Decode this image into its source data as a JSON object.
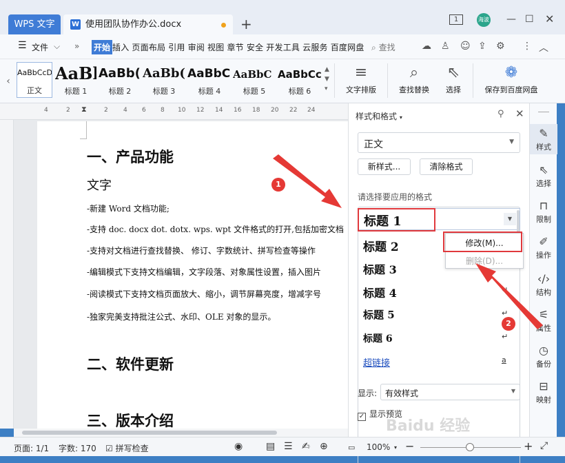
{
  "titlebar": {
    "app_tab": "WPS 文字",
    "doc_tab": "使用团队协作办公.docx",
    "new_tab": "+",
    "badge_count": "1",
    "avatar_text": "海波"
  },
  "menubar": {
    "file_label": "文件",
    "start_label": "开始",
    "items": "插入 页面布局 引用 审阅 视图 章节 安全 开发工具 云服务 百度网盘",
    "search_label": "查找"
  },
  "ribbon": {
    "styles": [
      {
        "preview": "AaBbCcDd",
        "label": "正文"
      },
      {
        "preview": "AaBl",
        "label": "标题 1"
      },
      {
        "preview": "AaBb(",
        "label": "标题 2"
      },
      {
        "preview": "AaBb(",
        "label": "标题 3"
      },
      {
        "preview": "AaBbC",
        "label": "标题 4"
      },
      {
        "preview": "AaBbC",
        "label": "标题 5"
      },
      {
        "preview": "AaBbCc",
        "label": "标题 6"
      }
    ],
    "tools": {
      "layout": "文字排版",
      "find_replace": "查找替换",
      "select": "选择",
      "save_baidu": "保存到百度网盘"
    }
  },
  "ruler": {
    "numbers": [
      "4",
      "2",
      "2",
      "4",
      "6",
      "8",
      "10",
      "12",
      "14",
      "16",
      "18",
      "20",
      "22",
      "24"
    ]
  },
  "document": {
    "h1_a": "一、产品功能",
    "sub": "文字",
    "lines": [
      "-新建 Word 文档功能;",
      "-支持 doc. docx dot. dotx. wps. wpt 文件格式的打开,包括加密文档",
      "-支持对文档进行查找替换、 修订、字数统计、拼写检查等操作",
      "-编辑模式下支持文档编辑，文字段落、对象属性设置，插入图片",
      "-阅读模式下支持文档页面放大、缩小，调节屏幕亮度，增减字号",
      "-独家完美支持批注公式、水印、OLE  对象的显示。"
    ],
    "h1_b": "二、软件更新",
    "h1_c": "三、版本介绍"
  },
  "panel": {
    "title": "样式和格式",
    "current_style": "正文",
    "new_style_btn": "新样式...",
    "clear_btn": "清除格式",
    "apply_label": "请选择要应用的格式",
    "list": [
      {
        "label": "标题 1",
        "mark": ""
      },
      {
        "label": "标题 2",
        "mark": "↵"
      },
      {
        "label": "标题 3",
        "mark": "↵"
      },
      {
        "label": "标题 4",
        "mark": "↵"
      },
      {
        "label": "标题 5",
        "mark": "↵"
      },
      {
        "label": "标题 6",
        "mark": "↵"
      },
      {
        "label": "超链接",
        "mark": "a"
      }
    ],
    "context_menu": {
      "modify": "修改(M)...",
      "delete": "删除(D)..."
    },
    "display_label": "显示:",
    "display_value": "有效样式",
    "preview_label": "显示预览",
    "preview_checked": "✓"
  },
  "sidebar": {
    "items": [
      "样式",
      "选择",
      "限制",
      "操作",
      "结构",
      "属性",
      "备份",
      "映射"
    ]
  },
  "statusbar": {
    "page": "页面: 1/1",
    "words": "字数: 170",
    "spell": "拼写检查",
    "zoom": "100%"
  },
  "annotations": {
    "badge1": "1",
    "badge2": "2"
  },
  "watermark": "Baidu 经验",
  "colors": {
    "accent": "#3f7cd6",
    "annotation_red": "#e53935"
  }
}
